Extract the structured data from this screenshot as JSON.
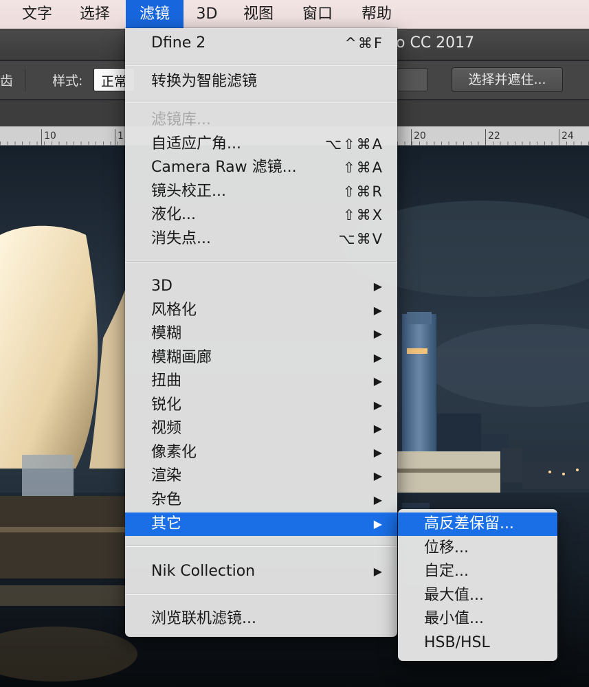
{
  "menubar": {
    "items": [
      "文字",
      "选择",
      "滤镜",
      "3D",
      "视图",
      "窗口",
      "帮助"
    ],
    "active_index": 2
  },
  "app": {
    "window_title": "o CC 2017",
    "antialias_stub": "齿",
    "style_label": "样式:",
    "style_value": "正常",
    "select_and_mask": "选择并遮住..."
  },
  "ruler": {
    "labels": [
      "10",
      "1",
      "20",
      "22",
      "24"
    ]
  },
  "filter_menu": {
    "top_item": {
      "label": "Dfine 2",
      "shortcut": "^⌘F"
    },
    "convert_smart": {
      "label": "转换为智能滤镜"
    },
    "gallery": {
      "label": "滤镜库...",
      "disabled": true
    },
    "filters": [
      {
        "label": "自适应广角...",
        "shortcut": "⌥⇧⌘A"
      },
      {
        "label": "Camera Raw 滤镜...",
        "shortcut": "⇧⌘A"
      },
      {
        "label": "镜头校正...",
        "shortcut": "⇧⌘R"
      },
      {
        "label": "液化...",
        "shortcut": "⇧⌘X"
      },
      {
        "label": "消失点...",
        "shortcut": "⌥⌘V"
      }
    ],
    "submenus": [
      {
        "label": "3D",
        "arrow": "▶"
      },
      {
        "label": "风格化",
        "arrow": "▶"
      },
      {
        "label": "模糊",
        "arrow": "▶"
      },
      {
        "label": "模糊画廊",
        "arrow": "▶"
      },
      {
        "label": "扭曲",
        "arrow": "▶"
      },
      {
        "label": "锐化",
        "arrow": "▶"
      },
      {
        "label": "视频",
        "arrow": "▶"
      },
      {
        "label": "像素化",
        "arrow": "▶"
      },
      {
        "label": "渲染",
        "arrow": "▶"
      },
      {
        "label": "杂色",
        "arrow": "▶"
      },
      {
        "label": "其它",
        "arrow": "▶",
        "highlighted": true
      }
    ],
    "plugins": [
      {
        "label": "Nik Collection",
        "arrow": "▶"
      }
    ],
    "browse_online": {
      "label": "浏览联机滤镜..."
    }
  },
  "other_submenu": {
    "items": [
      {
        "label": "高反差保留...",
        "highlighted": true
      },
      {
        "label": "位移..."
      },
      {
        "label": "自定..."
      },
      {
        "label": "最大值..."
      },
      {
        "label": "最小值..."
      },
      {
        "label": "HSB/HSL"
      }
    ]
  },
  "colors": {
    "highlight": "#1a6ee6",
    "menubar_active": "#1766dd",
    "menu_bg": "#e2e2e2"
  }
}
